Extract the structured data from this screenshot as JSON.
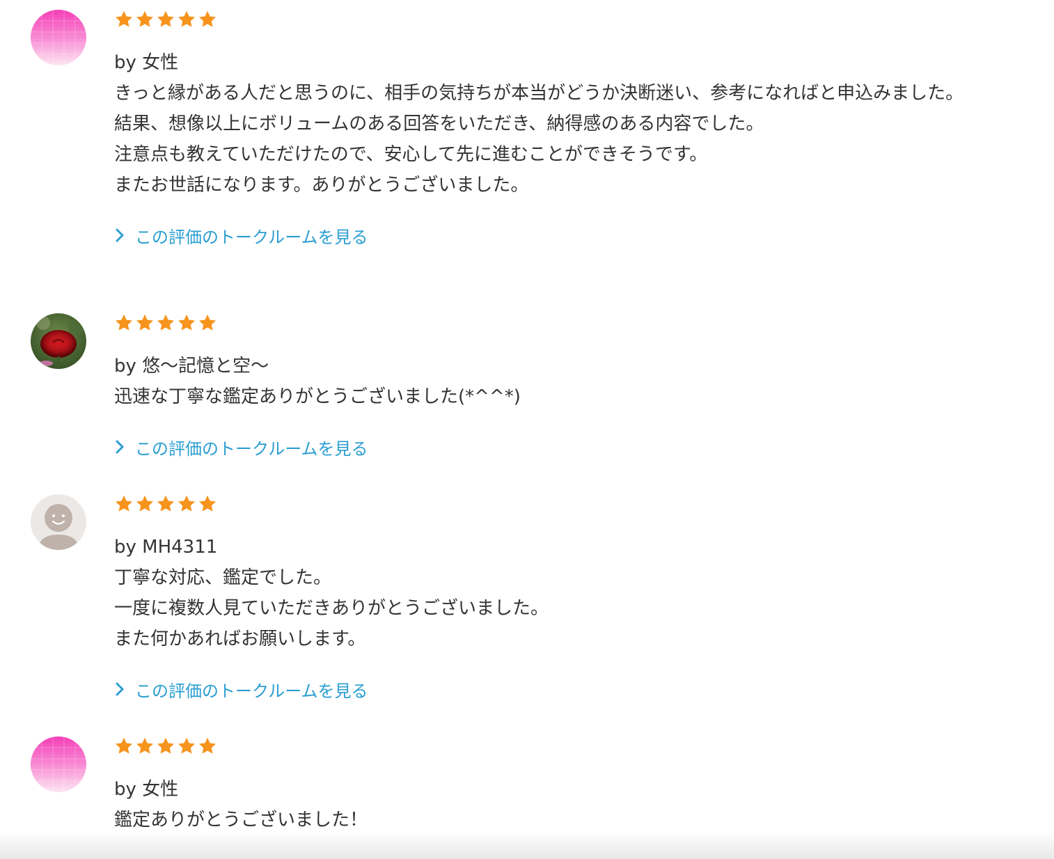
{
  "reviews": [
    {
      "avatar_icon": "pink-gradient-avatar-icon",
      "rating": 5,
      "reviewer": "by 女性",
      "lines": [
        "きっと縁がある人だと思うのに、相手の気持ちが本当がどうか決断迷い、参考になればと申込みました。",
        "結果、想像以上にボリュームのある回答をいただき、納得感のある内容でした。",
        "注意点も教えていただけたので、安心して先に進むことができそうです。",
        "またお世話になります。ありがとうございました。"
      ],
      "link_label": "この評価のトークルームを見る"
    },
    {
      "avatar_icon": "red-rose-photo-avatar-icon",
      "rating": 5,
      "reviewer": "by 悠〜記憶と空〜",
      "lines": [
        "迅速な丁寧な鑑定ありがとうございました(*^^*)"
      ],
      "link_label": "この評価のトークルームを見る"
    },
    {
      "avatar_icon": "default-person-avatar-icon",
      "rating": 5,
      "reviewer": "by MH4311",
      "lines": [
        "丁寧な対応、鑑定でした。",
        "一度に複数人見ていただきありがとうございました。",
        "また何かあればお願いします。"
      ],
      "link_label": "この評価のトークルームを見る"
    },
    {
      "avatar_icon": "pink-gradient-avatar-icon",
      "rating": 5,
      "reviewer": "by 女性",
      "lines": [
        "鑑定ありがとうございました！"
      ]
    }
  ],
  "colors": {
    "star": "#f7941d",
    "link": "#2b9ed1",
    "text": "#333333"
  }
}
